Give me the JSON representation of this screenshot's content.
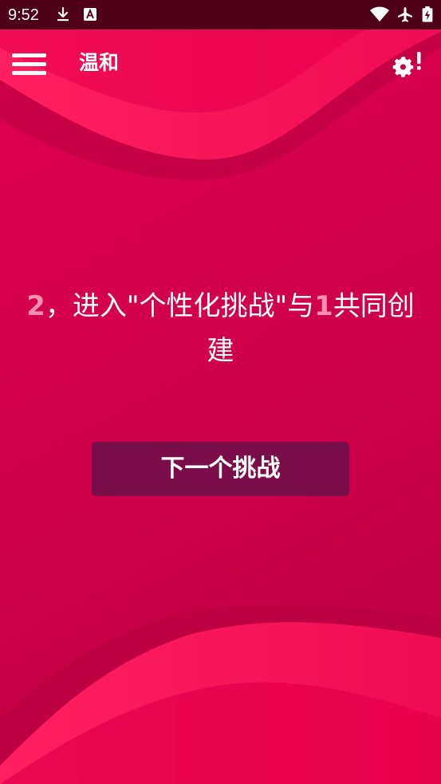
{
  "status_bar": {
    "time": "9:52",
    "icons": [
      "download-icon",
      "keyboard-a-icon",
      "wifi-icon",
      "airplane-mode-icon",
      "battery-charging-icon"
    ]
  },
  "app_bar": {
    "title": "温和",
    "menu_icon": "hamburger-menu-icon",
    "settings_icon": "settings-alert-icon"
  },
  "challenge": {
    "player_a": "2",
    "part1": "，进入\"个性化挑战\"与",
    "player_b": "1",
    "part2": "共同创建"
  },
  "next_button": {
    "label": "下一个挑战"
  },
  "colors": {
    "background": "#d1004b",
    "status_bar": "#4d0018",
    "wave": "#ff1a5e",
    "button": "#7a0e48",
    "player_number": "#ff8fb0"
  }
}
